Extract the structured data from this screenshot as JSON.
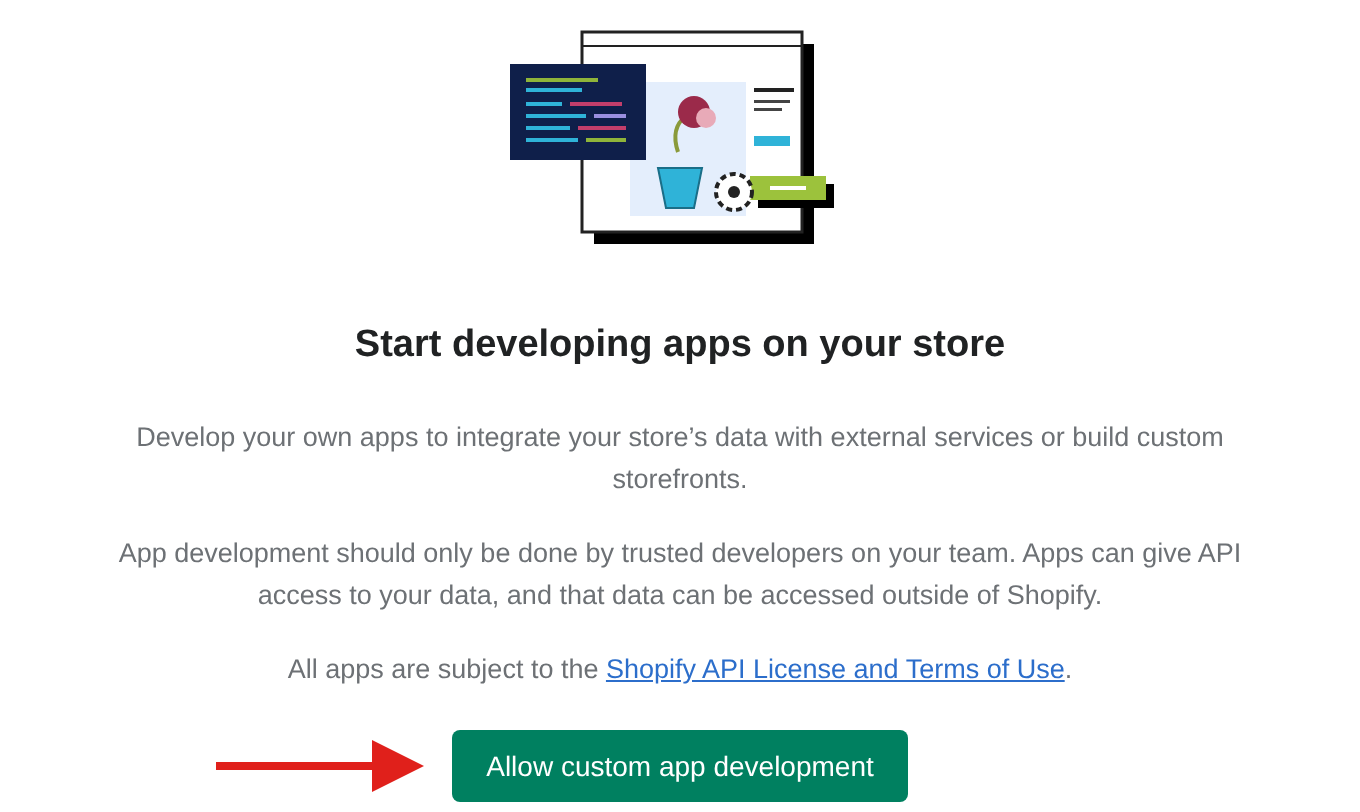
{
  "title": "Start developing apps on your store",
  "paragraphs": [
    "Develop your own apps to integrate your store’s data with external services or build custom storefronts.",
    "App development should only be done by trusted developers on your team. Apps can give API access to your data, and that data can be accessed outside of Shopify."
  ],
  "terms": {
    "before": "All apps are subject to the ",
    "link": "Shopify API License and Terms of Use",
    "after": "."
  },
  "button": {
    "label": "Allow custom app development"
  }
}
